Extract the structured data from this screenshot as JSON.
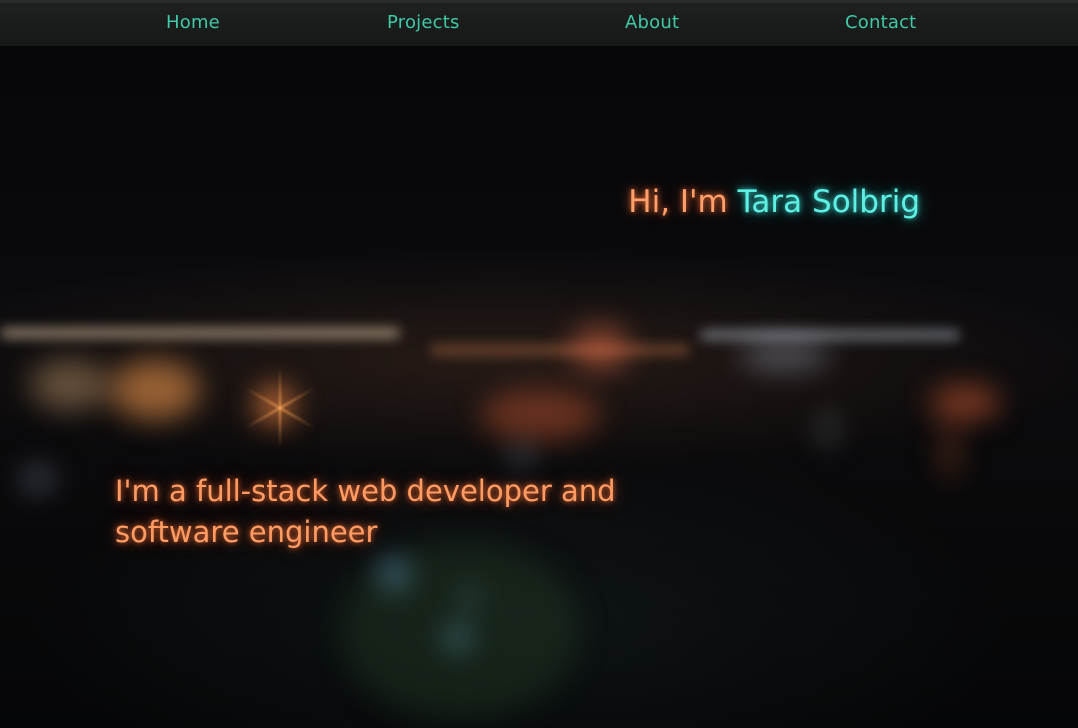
{
  "nav": {
    "items": [
      {
        "label": "Home"
      },
      {
        "label": "Projects"
      },
      {
        "label": "About"
      },
      {
        "label": "Contact"
      }
    ]
  },
  "hero": {
    "greeting": "Hi, I'm ",
    "name": "Tara Solbrig",
    "tagline": "I'm a full-stack web developer and software engineer"
  },
  "colors": {
    "nav_link": "#3fc9a8",
    "greeting": "#ff9f6a",
    "name": "#5ff0e4",
    "tagline": "#ff9c63",
    "nav_bg": "#1c1e1d"
  }
}
